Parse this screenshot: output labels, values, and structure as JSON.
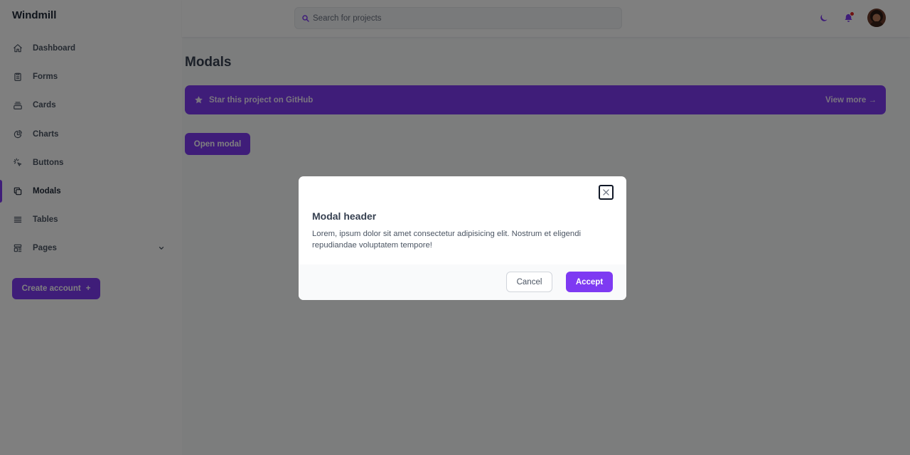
{
  "brand": "Windmill",
  "sidebar": {
    "items": [
      {
        "label": "Dashboard",
        "icon": "home-icon"
      },
      {
        "label": "Forms",
        "icon": "clipboard-icon"
      },
      {
        "label": "Cards",
        "icon": "cards-icon"
      },
      {
        "label": "Charts",
        "icon": "pie-chart-icon"
      },
      {
        "label": "Buttons",
        "icon": "cursor-click-icon"
      },
      {
        "label": "Modals",
        "icon": "duplicate-icon",
        "active": true
      },
      {
        "label": "Tables",
        "icon": "table-icon"
      },
      {
        "label": "Pages",
        "icon": "template-icon",
        "has_submenu": true
      }
    ],
    "create_account": "Create account",
    "create_account_suffix": "+"
  },
  "header": {
    "search_placeholder": "Search for projects",
    "notification_dot_color": "#e02424"
  },
  "main": {
    "title": "Modals",
    "banner": {
      "text": "Star this project on GitHub",
      "link": "View more →"
    },
    "open_modal": "Open modal"
  },
  "modal": {
    "title": "Modal header",
    "body": "Lorem, ipsum dolor sit amet consectetur adipisicing elit. Nostrum et eligendi repudiandae voluptatem tempore!",
    "cancel": "Cancel",
    "accept": "Accept"
  },
  "colors": {
    "accent": "#7e3af2",
    "overlay": "rgba(0,0,0,0.5)"
  }
}
